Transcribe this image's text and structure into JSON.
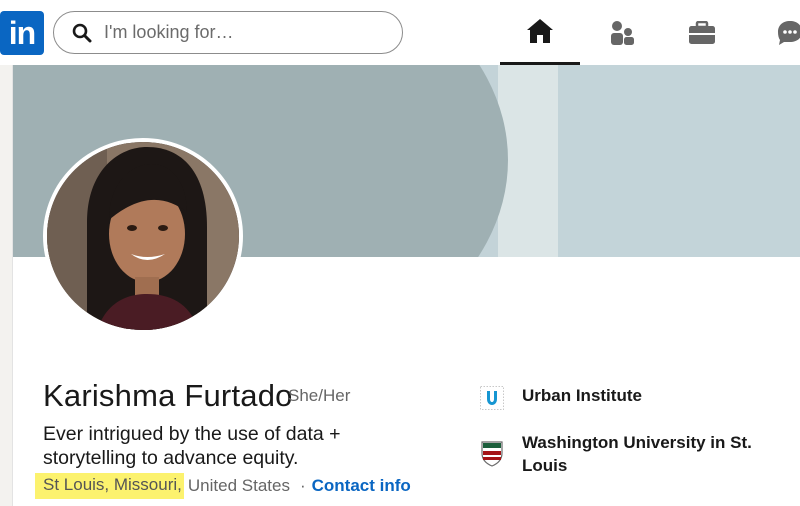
{
  "nav": {
    "logo_text": "in",
    "search_placeholder": "I'm looking for…",
    "items": [
      {
        "icon": "home-icon"
      },
      {
        "icon": "my-network-icon"
      },
      {
        "icon": "jobs-icon"
      },
      {
        "icon": "messaging-icon"
      }
    ]
  },
  "profile": {
    "name": "Karishma Furtado",
    "pronouns": "She/Her",
    "headline": "Ever intrigued by the use of data + storytelling to advance equity.",
    "location_highlighted": "St Louis, Missouri,",
    "location_country": "United States",
    "separator": "·",
    "contact_link": "Contact info"
  },
  "orgs": [
    {
      "label": "Urban Institute",
      "icon": "urban-institute-logo"
    },
    {
      "label": "Washington University in St. Louis",
      "icon": "washu-shield-logo"
    }
  ],
  "colors": {
    "brand": "#0a66c2",
    "highlight": "#fcf26e",
    "banner_dark": "#9fb0b3",
    "banner_light": "#c3d3d8"
  }
}
